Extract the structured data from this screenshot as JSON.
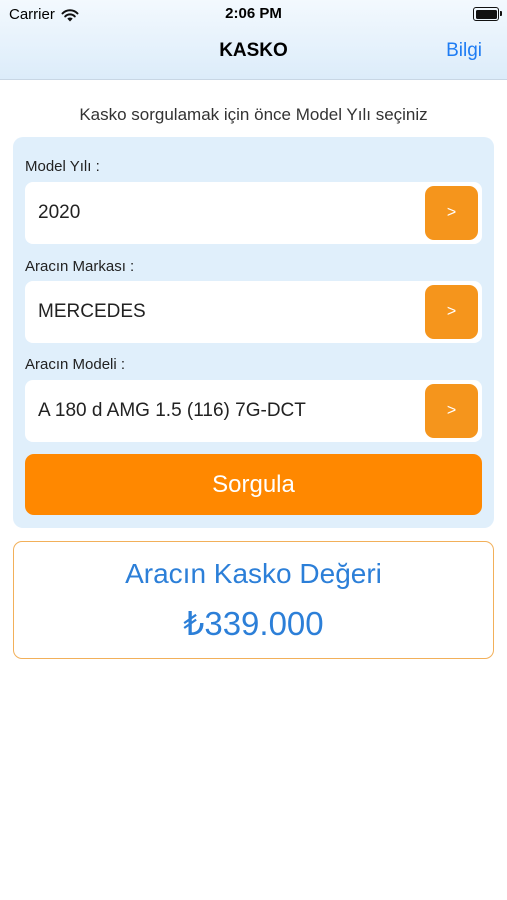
{
  "status_bar": {
    "carrier": "Carrier",
    "time": "2:06 PM",
    "wifi_icon": "wifi-icon",
    "battery_icon": "battery-full-icon",
    "battery_level": 1.0
  },
  "nav": {
    "title": "KASKO",
    "right_button": "Bilgi"
  },
  "instruction": "Kasko sorgulamak için önce Model Yılı seçiniz",
  "form": {
    "model_year": {
      "label": "Model Yılı :",
      "value": "2020",
      "button": ">"
    },
    "brand": {
      "label": "Aracın Markası :",
      "value": "MERCEDES",
      "button": ">"
    },
    "model": {
      "label": "Aracın Modeli :",
      "value": "A 180 d AMG 1.5 (116) 7G-DCT",
      "button": ">"
    },
    "submit": "Sorgula"
  },
  "result": {
    "title": "Aracın Kasko Değeri",
    "value": "₺339.000"
  },
  "colors": {
    "accent_orange": "#ff8800",
    "chevron_orange": "#f5951c",
    "link_blue": "#1e7cf3",
    "result_blue": "#2c7fd8",
    "panel_bg": "#e0effb",
    "result_border": "#f2b05a"
  }
}
